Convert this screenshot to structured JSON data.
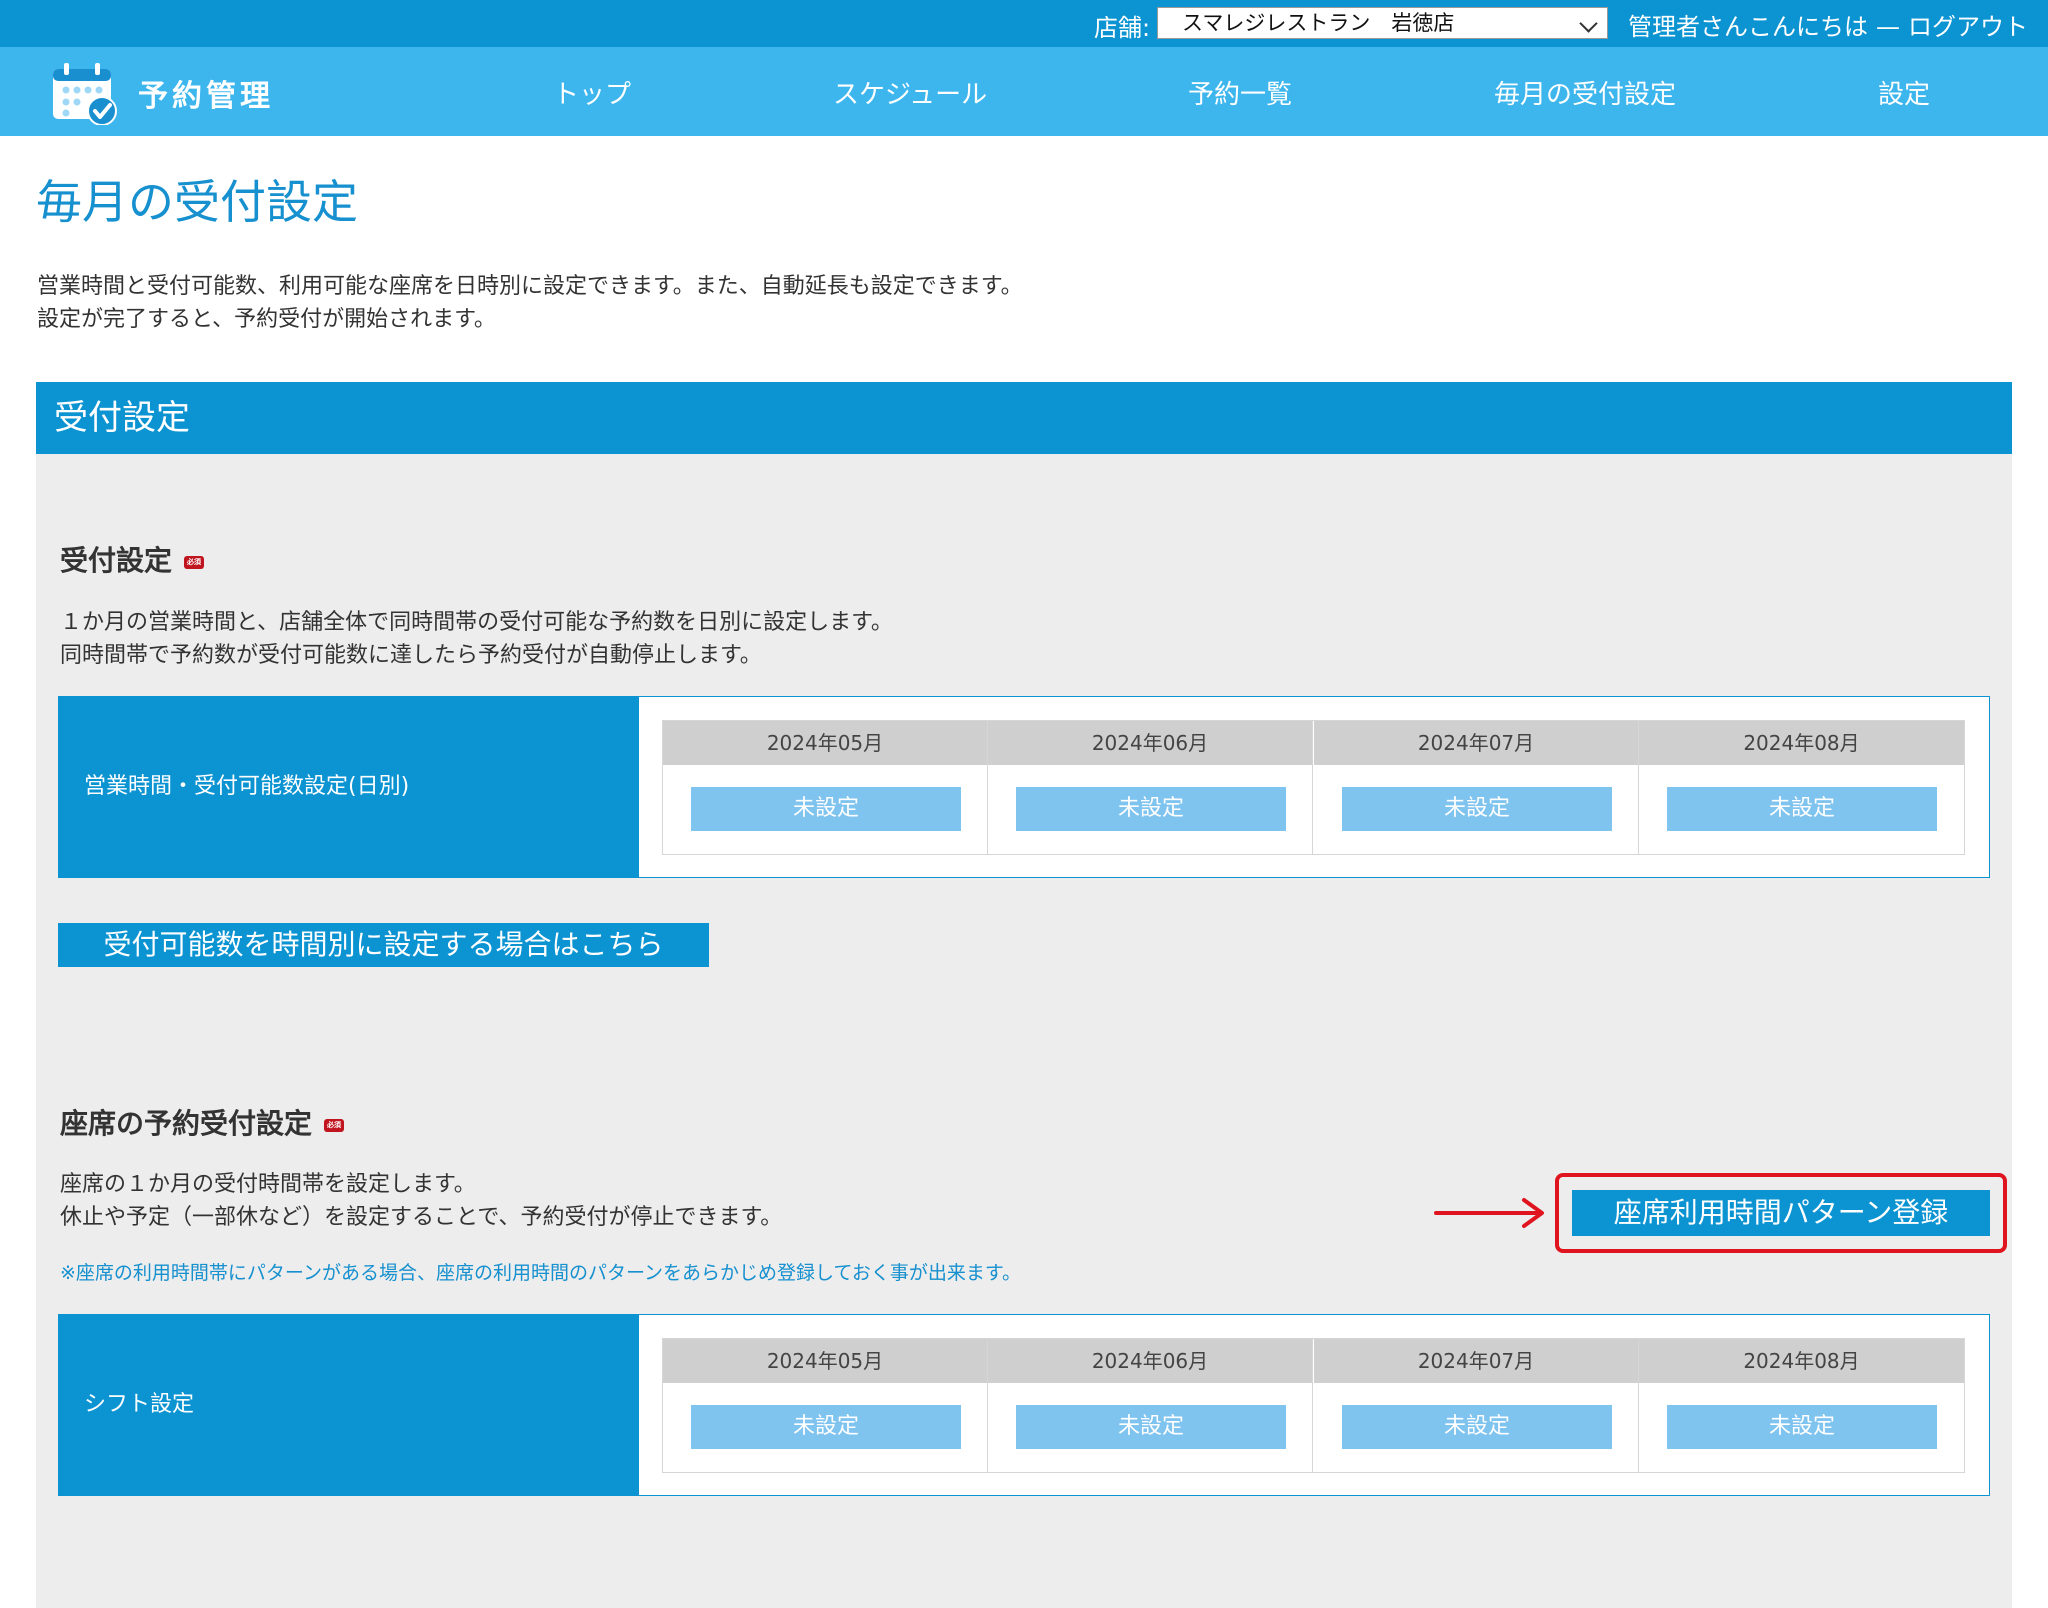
{
  "topbar": {
    "store_label": "店舗:",
    "store_value": "スマレジレストラン　岩徳店",
    "greeting": "管理者さんこんにちは",
    "separator": "—",
    "logout": "ログアウト"
  },
  "nav": {
    "logo_text": "予約管理",
    "items": [
      "トップ",
      "スケジュール",
      "予約一覧",
      "毎月の受付設定",
      "設定"
    ]
  },
  "page": {
    "title": "毎月の受付設定",
    "intro_line1": "営業時間と受付可能数、利用可能な座席を日時別に設定できます。また、自動延長も設定できます。",
    "intro_line2": "設定が完了すると、予約受付が開始されます。"
  },
  "section_header": "受付設定",
  "required_badge": "必須",
  "reception": {
    "title": "受付設定",
    "desc_line1": "１か月の営業時間と、店舗全体で同時間帯の受付可能な予約数を日別に設定します。",
    "desc_line2": "同時間帯で予約数が受付可能数に達したら予約受付が自動停止します。",
    "label": "営業時間・受付可能数設定(日別)",
    "months": [
      {
        "month": "2024年05月",
        "status": "未設定"
      },
      {
        "month": "2024年06月",
        "status": "未設定"
      },
      {
        "month": "2024年07月",
        "status": "未設定"
      },
      {
        "month": "2024年08月",
        "status": "未設定"
      }
    ],
    "time_button": "受付可能数を時間別に設定する場合はこちら"
  },
  "seat": {
    "title": "座席の予約受付設定",
    "desc_line1": "座席の１か月の受付時間帯を設定します。",
    "desc_line2": "休止や予定（一部休など）を設定することで、予約受付が停止できます。",
    "note": "※座席の利用時間帯にパターンがある場合、座席の利用時間のパターンをあらかじめ登録しておく事が出来ます。",
    "pattern_button": "座席利用時間パターン登録",
    "label": "シフト設定",
    "months": [
      {
        "month": "2024年05月",
        "status": "未設定"
      },
      {
        "month": "2024年06月",
        "status": "未設定"
      },
      {
        "month": "2024年07月",
        "status": "未設定"
      },
      {
        "month": "2024年08月",
        "status": "未設定"
      }
    ]
  },
  "colors": {
    "primary": "#0b93d2",
    "nav": "#3db6ee",
    "status_button": "#7fc3ef",
    "highlight": "#e0141e"
  }
}
